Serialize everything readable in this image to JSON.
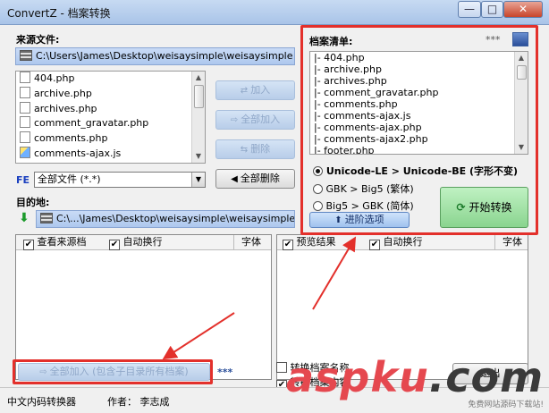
{
  "window": {
    "title": "ConvertZ - 档案转换",
    "minimize": "—",
    "maximize": "□",
    "close": "✕"
  },
  "source": {
    "label": "来源文件:",
    "path": "C:\\Users\\James\\Desktop\\weisaysimple\\weisaysimple",
    "files": [
      "404.php",
      "archive.php",
      "archives.php",
      "comment_gravatar.php",
      "comments.php",
      "comments-ajax.js"
    ]
  },
  "buttons": {
    "add": "加入",
    "add_all": "全部加入",
    "remove": "删除",
    "remove_all": "全部删除"
  },
  "filter": {
    "fe_label": "FE",
    "value": "全部文件 (*.*)"
  },
  "destination": {
    "label": "目的地:",
    "path": "C:\\...\\James\\Desktop\\weisaysimple\\weisaysimple-new"
  },
  "file_list": {
    "label": "档案清单:",
    "stars": "***",
    "items": [
      "|- 404.php",
      "|- archive.php",
      "|- archives.php",
      "|- comment_gravatar.php",
      "|- comments.php",
      "|- comments-ajax.js",
      "|- comments-ajax.php",
      "|- comments-ajax2.php",
      "|- footer.php"
    ]
  },
  "encoding": {
    "options": [
      {
        "label": "Unicode-LE > Unicode-BE (字形不变)",
        "selected": true
      },
      {
        "label": "GBK > Big5 (繁体)",
        "selected": false
      },
      {
        "label": "Big5 > GBK (简体)",
        "selected": false
      }
    ],
    "advanced": "进阶选项",
    "start": "开始转换"
  },
  "left_panel": {
    "view_source": "查看来源档",
    "wrap": "自动换行",
    "font": "字体"
  },
  "right_panel": {
    "preview": "预览结果",
    "wrap": "自动换行",
    "font": "字体"
  },
  "bottom": {
    "add_all_sub": "全部加入 (包含子目录所有档案)",
    "stars": "***",
    "convert_name": "转换档案名称",
    "convert_content": "转换档案内容",
    "exit": "退出"
  },
  "status": {
    "app": "中文内码转换器",
    "author": "作者： 李志成"
  },
  "watermark": {
    "brand_a": "asp",
    "brand_b": "ku",
    "brand_c": ".com",
    "tagline": "免费网站源码下载站!"
  },
  "colors": {
    "accent_red": "#e3302b",
    "start_green": "#8ad48f"
  }
}
